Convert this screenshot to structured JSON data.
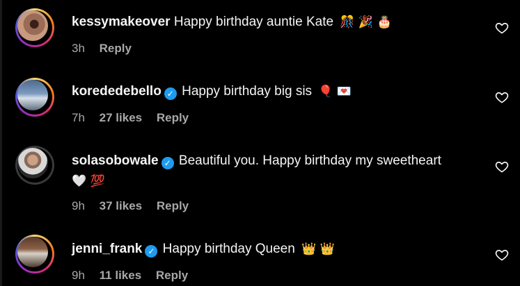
{
  "comments": [
    {
      "username": "kessymakeover",
      "verified": false,
      "text": "Happy birthday auntie Kate",
      "emojis": "🎊 🎉 🎂",
      "time": "3h",
      "likes": "",
      "reply": "Reply"
    },
    {
      "username": "korededebello",
      "verified": true,
      "text": "Happy birthday big sis",
      "emojis": "🎈 💌",
      "time": "7h",
      "likes": "27 likes",
      "reply": "Reply"
    },
    {
      "username": "solasobowale",
      "verified": true,
      "text": "Beautiful you. Happy birthday my sweetheart",
      "text2": "🤍 💯",
      "time": "9h",
      "likes": "37 likes",
      "reply": "Reply"
    },
    {
      "username": "jenni_frank",
      "verified": true,
      "text": "Happy birthday Queen",
      "emojis": "👑 👑",
      "time": "9h",
      "likes": "11 likes",
      "reply": "Reply"
    }
  ],
  "icons": {
    "like": "heart-outline-icon",
    "verified": "verified-badge-icon"
  },
  "colors": {
    "background": "#000000",
    "text": "#f5f5f5",
    "meta": "#a8a8a8",
    "verified": "#1d9bf0"
  }
}
